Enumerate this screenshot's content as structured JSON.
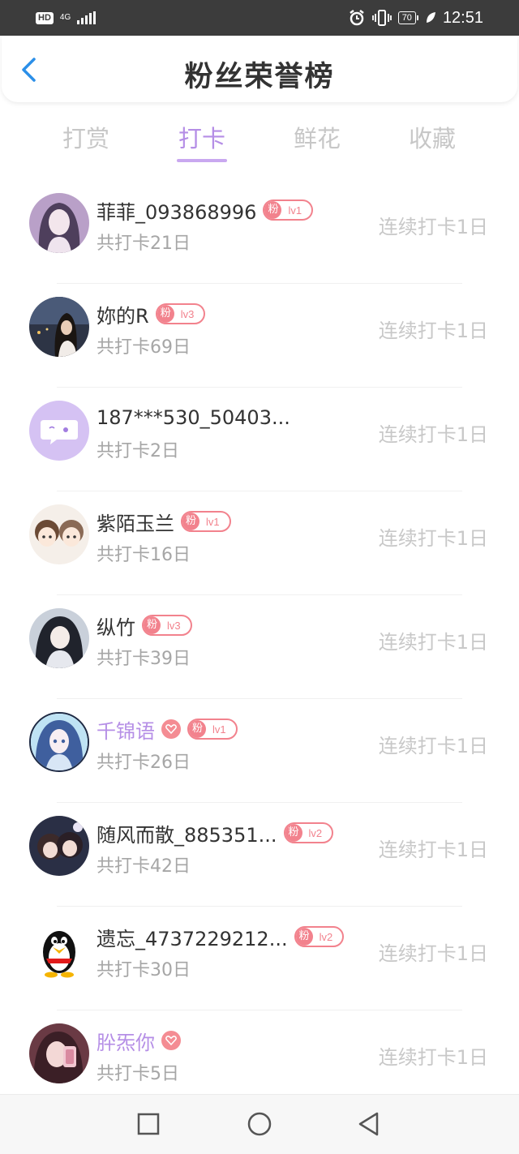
{
  "status_bar": {
    "hd": "HD",
    "network": "4G",
    "battery": "70",
    "time": "12:51"
  },
  "header": {
    "title": "粉丝荣誉榜"
  },
  "tabs": [
    {
      "label": "打赏",
      "active": false
    },
    {
      "label": "打卡",
      "active": true
    },
    {
      "label": "鲜花",
      "active": false
    },
    {
      "label": "收藏",
      "active": false
    }
  ],
  "rows": [
    {
      "name": "菲菲_093868996",
      "vip": false,
      "heart": false,
      "fan_label": "粉",
      "level": "lv1",
      "total": "共打卡21日",
      "streak": "连续打卡1日"
    },
    {
      "name": "妳的R",
      "vip": false,
      "heart": false,
      "fan_label": "粉",
      "level": "lv3",
      "total": "共打卡69日",
      "streak": "连续打卡1日"
    },
    {
      "name": "187***530_50403...",
      "vip": false,
      "heart": false,
      "fan_label": "",
      "level": "",
      "total": "共打卡2日",
      "streak": "连续打卡1日"
    },
    {
      "name": "紫陌玉兰",
      "vip": false,
      "heart": false,
      "fan_label": "粉",
      "level": "lv1",
      "total": "共打卡16日",
      "streak": "连续打卡1日"
    },
    {
      "name": "纵竹",
      "vip": false,
      "heart": false,
      "fan_label": "粉",
      "level": "lv3",
      "total": "共打卡39日",
      "streak": "连续打卡1日"
    },
    {
      "name": "千锦语",
      "vip": true,
      "heart": true,
      "fan_label": "粉",
      "level": "lv1",
      "total": "共打卡26日",
      "streak": "连续打卡1日"
    },
    {
      "name": "随风而散_885351...",
      "vip": false,
      "heart": false,
      "fan_label": "粉",
      "level": "lv2",
      "total": "共打卡42日",
      "streak": "连续打卡1日"
    },
    {
      "name": "遗忘_4737229212...",
      "vip": false,
      "heart": false,
      "fan_label": "粉",
      "level": "lv2",
      "total": "共打卡30日",
      "streak": "连续打卡1日"
    },
    {
      "name": "肸炁你",
      "vip": true,
      "heart": true,
      "fan_label": "",
      "level": "",
      "total": "共打卡5日",
      "streak": "连续打卡1日"
    }
  ],
  "colors": {
    "accent": "#b58ee6",
    "badge": "#f2828d",
    "muted": "#c8c8c8"
  },
  "nav": {
    "recent": "square-icon",
    "home": "circle-icon",
    "back": "triangle-back-icon"
  }
}
